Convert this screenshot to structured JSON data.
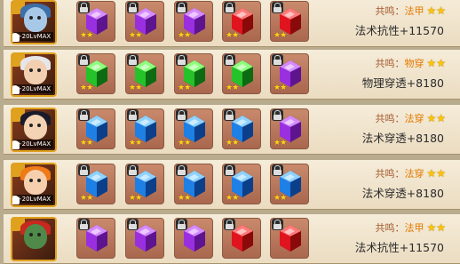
{
  "gem_colors": {
    "purple": [
      "#d58bff",
      "#9a2fe0",
      "#5e148f"
    ],
    "red": [
      "#ff7a7a",
      "#e0141e",
      "#8a0a0a"
    ],
    "green": [
      "#8dff7c",
      "#25c22a",
      "#0d6b12"
    ],
    "blue": [
      "#8ed2ff",
      "#1e7fe5",
      "#0b3f8a"
    ]
  },
  "rows": [
    {
      "hero": {
        "level_label": "+20LvMAX",
        "hair": "#3d6fa8",
        "skin": "#a8c8e8"
      },
      "gems": [
        {
          "color": "purple",
          "locked": true,
          "stars": "★★"
        },
        {
          "color": "purple",
          "locked": true,
          "stars": "★★"
        },
        {
          "color": "purple",
          "locked": true,
          "stars": "★★"
        },
        {
          "color": "red",
          "locked": true,
          "stars": "★★"
        },
        {
          "color": "red",
          "locked": true,
          "stars": "★★"
        }
      ],
      "resonance": {
        "prefix": "共鸣：",
        "type": "法甲",
        "stars": "★★"
      },
      "bonus": "法术抗性+11570"
    },
    {
      "hero": {
        "level_label": "+20LvMAX",
        "hair": "#e6e6ea",
        "skin": "#f2cfb0"
      },
      "gems": [
        {
          "color": "green",
          "locked": true,
          "stars": "★★"
        },
        {
          "color": "green",
          "locked": true,
          "stars": "★★"
        },
        {
          "color": "green",
          "locked": true,
          "stars": "★★"
        },
        {
          "color": "green",
          "locked": true,
          "stars": "★★"
        },
        {
          "color": "purple",
          "locked": true,
          "stars": "★★"
        }
      ],
      "resonance": {
        "prefix": "共鸣：",
        "type": "物穿",
        "stars": "★★"
      },
      "bonus": "物理穿透+8180"
    },
    {
      "hero": {
        "level_label": "+20LvMAX",
        "hair": "#1a1a2a",
        "skin": "#f4d2b4"
      },
      "gems": [
        {
          "color": "blue",
          "locked": true,
          "stars": "★★"
        },
        {
          "color": "blue",
          "locked": true,
          "stars": "★★"
        },
        {
          "color": "blue",
          "locked": true,
          "stars": "★★"
        },
        {
          "color": "blue",
          "locked": true,
          "stars": "★★"
        },
        {
          "color": "purple",
          "locked": true,
          "stars": "★★"
        }
      ],
      "resonance": {
        "prefix": "共鸣：",
        "type": "法穿",
        "stars": "★★"
      },
      "bonus": "法术穿透+8180"
    },
    {
      "hero": {
        "level_label": "+20LvMAX",
        "hair": "#f07a18",
        "skin": "#f6d0ae"
      },
      "gems": [
        {
          "color": "blue",
          "locked": true,
          "stars": "★★"
        },
        {
          "color": "blue",
          "locked": true,
          "stars": "★★"
        },
        {
          "color": "blue",
          "locked": true,
          "stars": "★★"
        },
        {
          "color": "blue",
          "locked": true,
          "stars": "★★"
        },
        {
          "color": "blue",
          "locked": true,
          "stars": "★★"
        }
      ],
      "resonance": {
        "prefix": "共鸣：",
        "type": "法穿",
        "stars": "★★"
      },
      "bonus": "法术穿透+8180"
    },
    {
      "hero": {
        "level_label": "",
        "hair": "#c8281e",
        "skin": "#4f8a4a"
      },
      "gems": [
        {
          "color": "purple",
          "locked": true,
          "stars": ""
        },
        {
          "color": "purple",
          "locked": true,
          "stars": ""
        },
        {
          "color": "purple",
          "locked": true,
          "stars": ""
        },
        {
          "color": "red",
          "locked": true,
          "stars": ""
        },
        {
          "color": "red",
          "locked": true,
          "stars": ""
        }
      ],
      "resonance": {
        "prefix": "共鸣：",
        "type": "法甲",
        "stars": "★★"
      },
      "bonus": "法术抗性+11570"
    }
  ]
}
